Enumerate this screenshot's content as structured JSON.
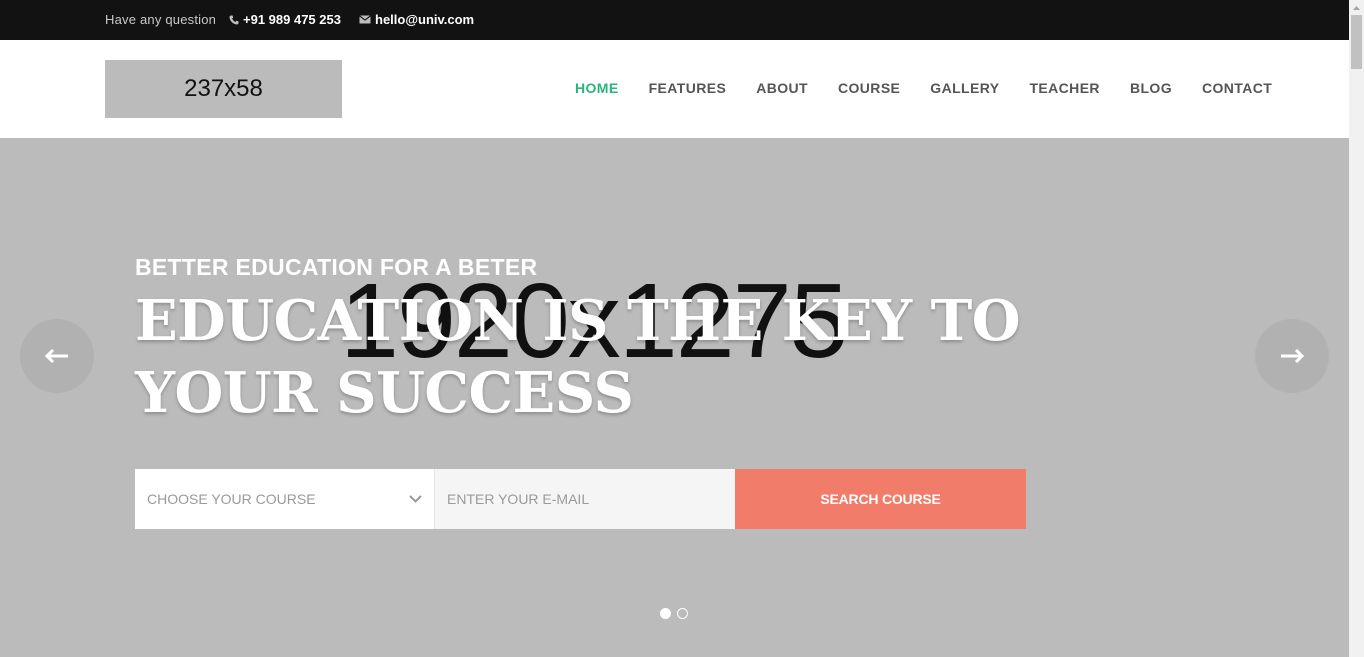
{
  "topbar": {
    "question": "Have any question",
    "phone": "+91 989 475 253",
    "email": "hello@univ.com"
  },
  "logo": {
    "text": "237x58"
  },
  "nav": [
    "HOME",
    "FEATURES",
    "ABOUT",
    "COURSE",
    "GALLERY",
    "TEACHER",
    "BLOG",
    "CONTACT"
  ],
  "nav_active": "HOME",
  "hero": {
    "bg_placeholder": "1920x1275",
    "eyebrow": "BETTER EDUCATION FOR A BETER",
    "headline": "EDUCATION IS THE KEY TO YOUR SUCCESS",
    "select_value": "CHOOSE YOUR COURSE",
    "email_placeholder": "ENTER YOUR E-MAIL",
    "search_button": "SEARCH COURSE",
    "slides": 2,
    "active_slide": 1
  },
  "colors": {
    "accent": "#28b57d",
    "button": "#f27c6a",
    "topbar": "#121212",
    "hero_bg": "#bbbbbb"
  },
  "icons": [
    "phone-icon",
    "envelope-icon",
    "arrow-left-icon",
    "arrow-right-icon",
    "chevron-down-icon"
  ]
}
